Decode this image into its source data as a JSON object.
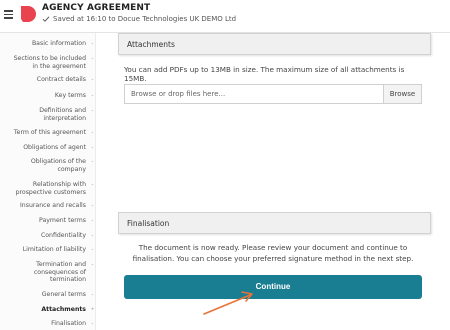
{
  "header": {
    "title": "AGENCY AGREEMENT",
    "save_status": "Saved at 16:10 to Docue Technologies UK DEMO Ltd",
    "logo_color": "#e8434f"
  },
  "sidebar": {
    "items": [
      {
        "label": "Basic information",
        "active": false
      },
      {
        "label": "Sections to be included in the agreement",
        "active": false
      },
      {
        "label": "Contract details",
        "active": false
      },
      {
        "label": "Key terms",
        "active": false
      },
      {
        "label": "Definitions and interpretation",
        "active": false
      },
      {
        "label": "Term of this agreement",
        "active": false
      },
      {
        "label": "Obligations of agent",
        "active": false
      },
      {
        "label": "Obligations of the company",
        "active": false
      },
      {
        "label": "Relationship with prospective customers",
        "active": false
      },
      {
        "label": "Insurance and recalls",
        "active": false
      },
      {
        "label": "Payment terms",
        "active": false
      },
      {
        "label": "Confidentiality",
        "active": false
      },
      {
        "label": "Limitation of liability",
        "active": false
      },
      {
        "label": "Termination and consequences of termination",
        "active": false
      },
      {
        "label": "General terms",
        "active": false
      },
      {
        "label": "Attachments",
        "active": true
      },
      {
        "label": "Finalisation",
        "active": false
      }
    ]
  },
  "attachments": {
    "heading": "Attachments",
    "info": "You can add PDFs up to 13MB in size. The maximum size of all attachments is 15MB.",
    "file_placeholder": "Browse or drop files here...",
    "browse_label": "Browse"
  },
  "finalisation": {
    "heading": "Finalisation",
    "info": "The document is now ready. Please review your document and continue to finalisation. You can choose your preferred signature method in the next step.",
    "continue_label": "Continue"
  },
  "colors": {
    "accent": "#1a7e93",
    "arrow": "#e8733a"
  }
}
